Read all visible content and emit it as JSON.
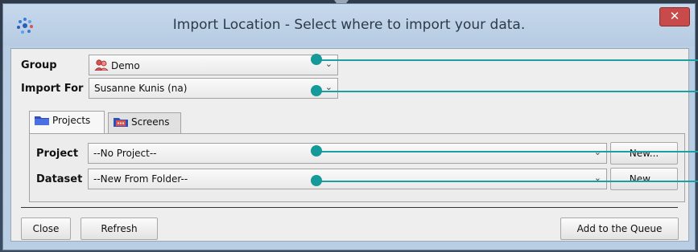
{
  "window": {
    "title": "Import Location - Select where to import your data.",
    "close_glyph": "✕",
    "app_icon": "app-logo-icon"
  },
  "form": {
    "group_label": "Group",
    "group_value": "Demo",
    "import_for_label": "Import For",
    "import_for_value": "Susanne Kunis (na)",
    "tabs": [
      {
        "label": "Projects"
      },
      {
        "label": "Screens"
      }
    ],
    "project_label": "Project",
    "project_value": "--No Project--",
    "dataset_label": "Dataset",
    "dataset_value": "--New From Folder--",
    "new_label": "New..."
  },
  "buttons": {
    "close": "Close",
    "refresh": "Refresh",
    "add_queue": "Add to the Queue"
  },
  "colors": {
    "pointer": "#1aa0a0",
    "close_button": "#c94a4a"
  }
}
